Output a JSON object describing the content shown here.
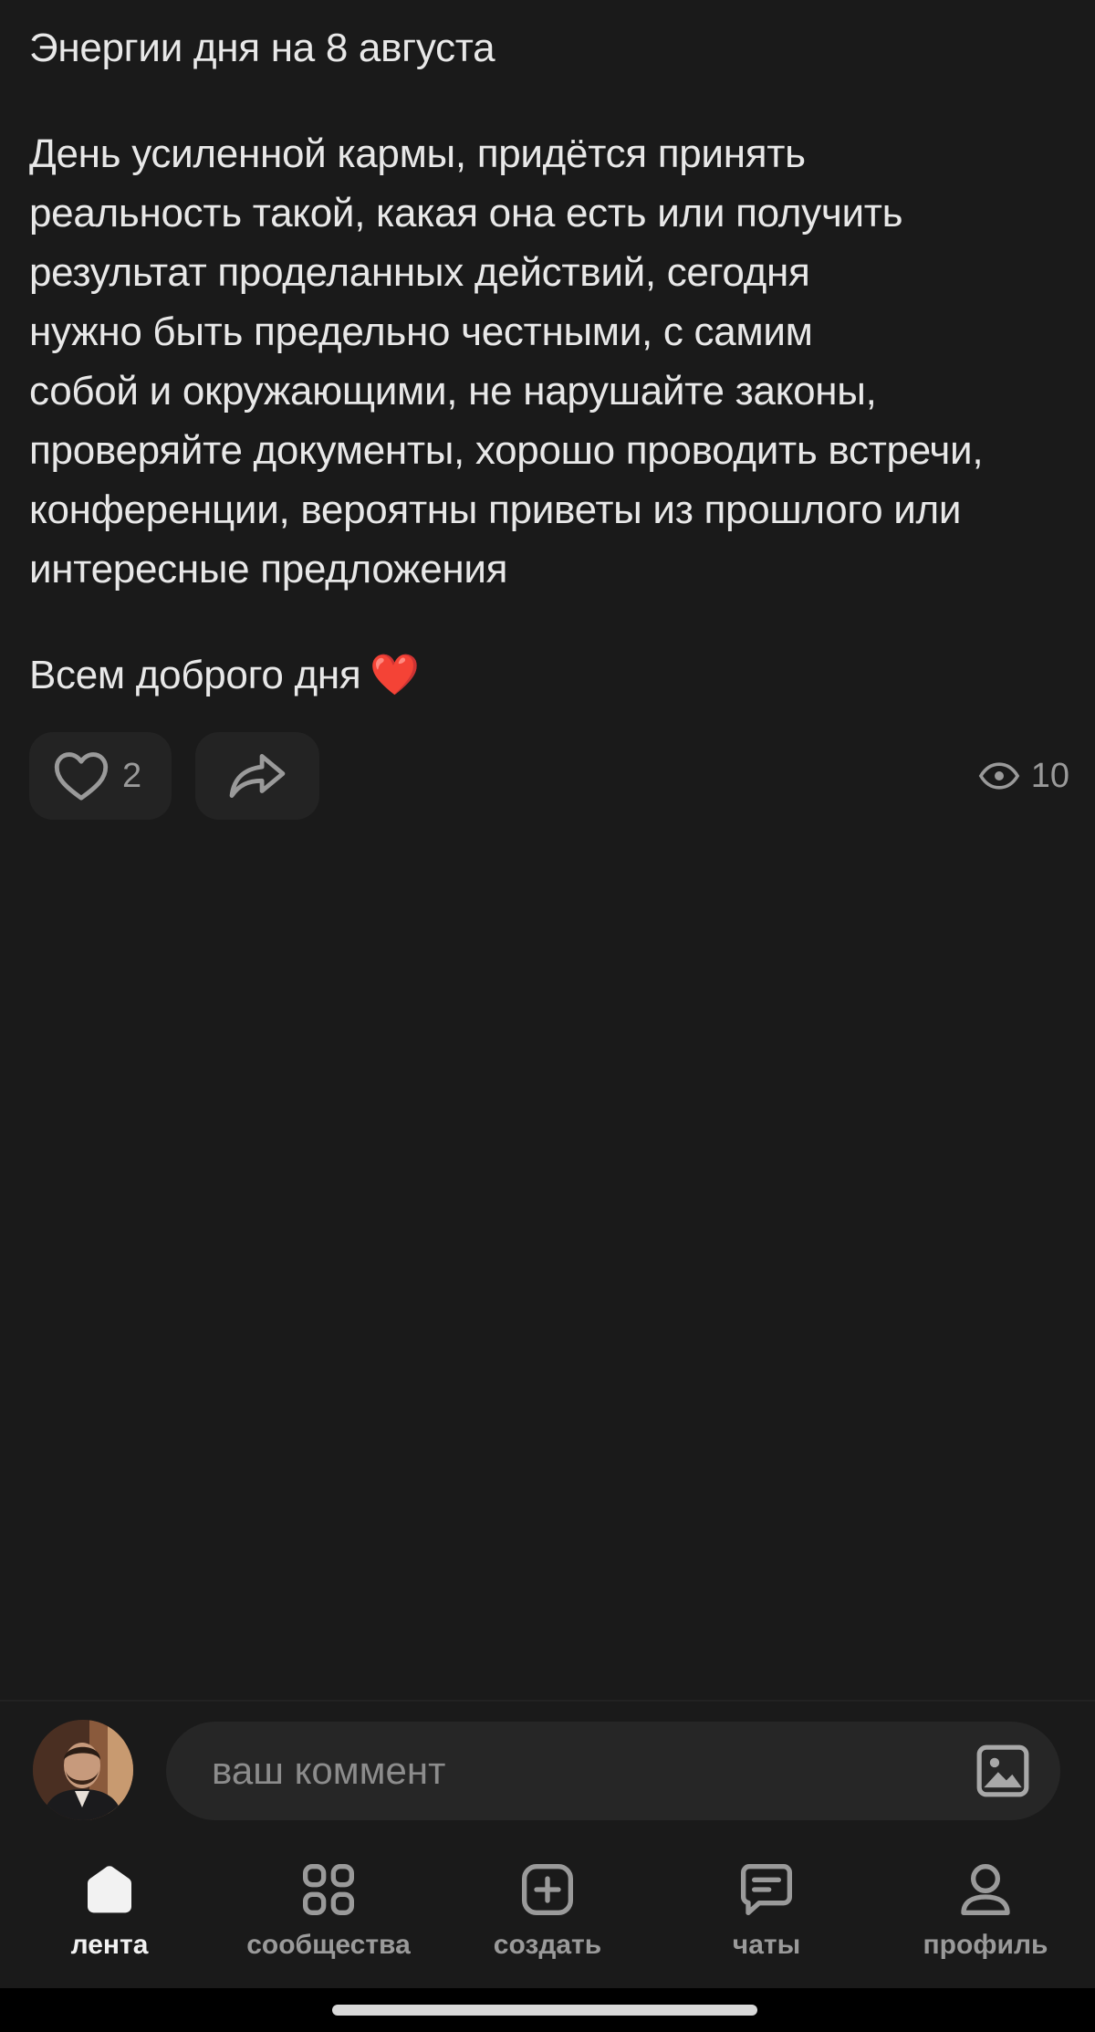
{
  "post": {
    "title": "Энергии дня на 8 августа",
    "body": "День усиленной кармы, придётся принять\nреальность такой, какая она есть или получить\nрезультат проделанных действий, сегодня\nнужно быть предельно честными, с самим\nсобой и окружающими, не нарушайте законы,\nпроверяйте документы, хорошо проводить встречи,\nконференции, вероятны приветы из прошлого или\nинтересные предложения",
    "closing": "Всем доброго дня",
    "closing_emoji": "❤️"
  },
  "actions": {
    "like_icon": "heart-outline-icon",
    "likes": "2",
    "share_icon": "share-arrow-icon",
    "views_icon": "eye-icon",
    "views": "10"
  },
  "comment": {
    "placeholder": "ваш коммент",
    "attach_icon": "image-icon"
  },
  "tabs": [
    {
      "label": "лента",
      "icon": "home-icon"
    },
    {
      "label": "сообщества",
      "icon": "grid-icon"
    },
    {
      "label": "создать",
      "icon": "plus-square-icon"
    },
    {
      "label": "чаты",
      "icon": "chat-icon"
    },
    {
      "label": "профиль",
      "icon": "user-icon"
    }
  ],
  "colors": {
    "background": "#1a1a1a",
    "text": "#e8e8e8",
    "muted": "#9a9a9a",
    "heart": "#e0262d"
  }
}
